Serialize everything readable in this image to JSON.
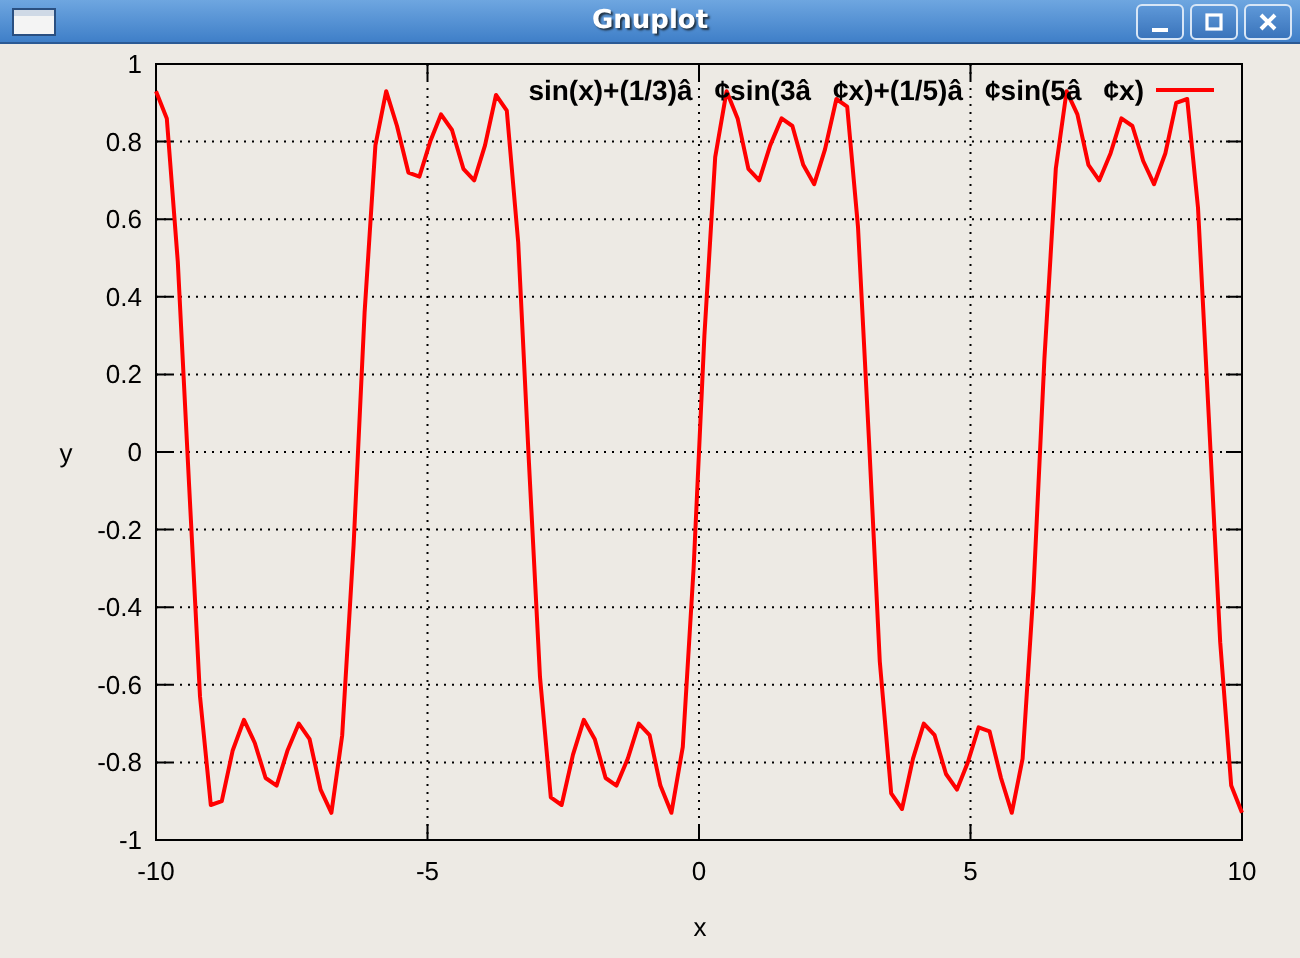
{
  "window": {
    "title": "Gnuplot"
  },
  "plot": {
    "chart_data": {
      "type": "line",
      "grid": true,
      "xlabel": "x",
      "ylabel": "y",
      "xlim": [
        -10,
        10
      ],
      "ylim": [
        -1,
        1
      ],
      "xticks": [
        -10,
        -5,
        0,
        5,
        10
      ],
      "yticks": [
        -1,
        -0.8,
        -0.6,
        -0.4,
        -0.2,
        0,
        0.2,
        0.4,
        0.6,
        0.8,
        1
      ],
      "x": [
        -10.0,
        -9.8,
        -9.6,
        -9.39,
        -9.19,
        -8.99,
        -8.79,
        -8.59,
        -8.38,
        -8.18,
        -7.98,
        -7.78,
        -7.58,
        -7.37,
        -7.17,
        -6.97,
        -6.77,
        -6.57,
        -6.36,
        -6.16,
        -5.96,
        -5.76,
        -5.56,
        -5.35,
        -5.15,
        -4.95,
        -4.75,
        -4.55,
        -4.34,
        -4.14,
        -3.94,
        -3.74,
        -3.54,
        -3.33,
        -3.13,
        -2.93,
        -2.73,
        -2.53,
        -2.32,
        -2.12,
        -1.92,
        -1.72,
        -1.52,
        -1.31,
        -1.11,
        -0.91,
        -0.71,
        -0.51,
        -0.3,
        -0.1,
        0.1,
        0.3,
        0.51,
        0.71,
        0.91,
        1.11,
        1.31,
        1.52,
        1.72,
        1.92,
        2.12,
        2.32,
        2.53,
        2.73,
        2.93,
        3.13,
        3.33,
        3.54,
        3.74,
        3.94,
        4.14,
        4.34,
        4.55,
        4.75,
        4.95,
        5.15,
        5.35,
        5.56,
        5.76,
        5.96,
        6.16,
        6.36,
        6.57,
        6.77,
        6.97,
        7.17,
        7.37,
        7.58,
        7.78,
        7.98,
        8.18,
        8.38,
        8.59,
        8.79,
        8.99,
        9.19,
        9.39,
        9.6,
        9.8,
        10.0
      ],
      "series": [
        {
          "name": "sin(x)+(1/3)â¢sin(3â¢x)+(1/5)â¢sin(5â¢x)",
          "color": "#ff0000",
          "values": [
            0.93,
            0.86,
            0.49,
            -0.09,
            -0.63,
            -0.91,
            -0.9,
            -0.77,
            -0.69,
            -0.75,
            -0.84,
            -0.86,
            -0.77,
            -0.7,
            -0.74,
            -0.87,
            -0.93,
            -0.73,
            -0.24,
            0.36,
            0.79,
            0.93,
            0.84,
            0.72,
            0.71,
            0.8,
            0.87,
            0.83,
            0.73,
            0.7,
            0.79,
            0.92,
            0.88,
            0.54,
            -0.03,
            -0.58,
            -0.89,
            -0.91,
            -0.78,
            -0.69,
            -0.74,
            -0.84,
            -0.86,
            -0.79,
            -0.7,
            -0.73,
            -0.86,
            -0.93,
            -0.76,
            -0.3,
            0.3,
            0.76,
            0.93,
            0.86,
            0.73,
            0.7,
            0.79,
            0.86,
            0.84,
            0.74,
            0.69,
            0.78,
            0.91,
            0.89,
            0.58,
            0.03,
            -0.54,
            -0.88,
            -0.92,
            -0.79,
            -0.7,
            -0.73,
            -0.83,
            -0.87,
            -0.8,
            -0.71,
            -0.72,
            -0.84,
            -0.93,
            -0.79,
            -0.36,
            0.24,
            0.73,
            0.93,
            0.87,
            0.74,
            0.7,
            0.77,
            0.86,
            0.84,
            0.75,
            0.69,
            0.77,
            0.9,
            0.91,
            0.63,
            0.09,
            -0.49,
            -0.86,
            -0.93
          ]
        }
      ]
    }
  }
}
